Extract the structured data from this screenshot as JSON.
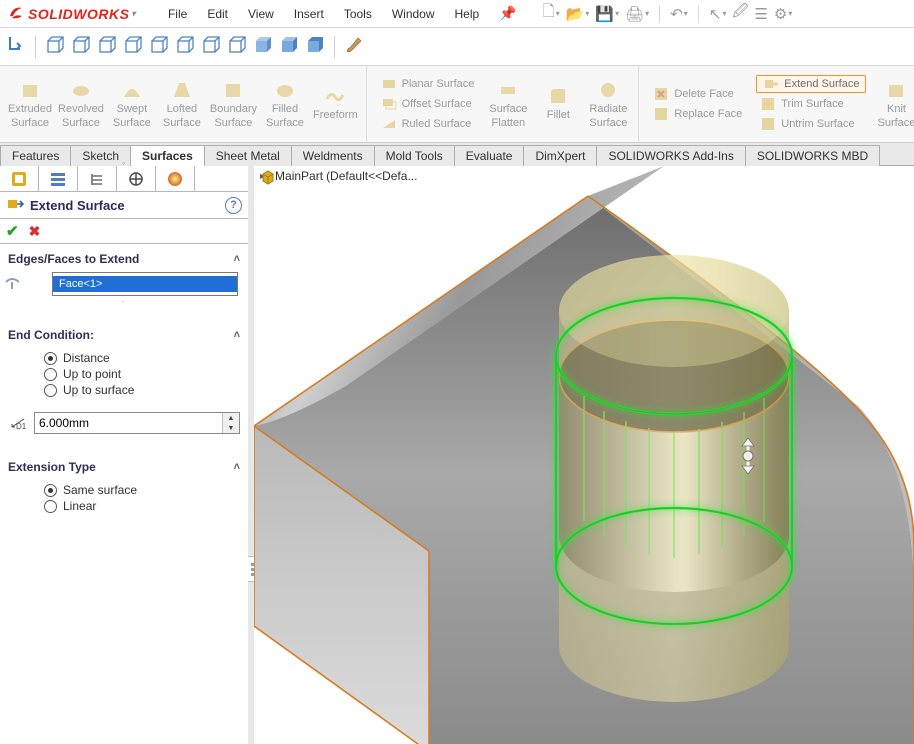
{
  "app": {
    "name": "SOLIDWORKS"
  },
  "menu": {
    "items": [
      "File",
      "Edit",
      "View",
      "Insert",
      "Tools",
      "Window",
      "Help"
    ]
  },
  "ribbon": {
    "big": [
      {
        "l1": "Extruded",
        "l2": "Surface"
      },
      {
        "l1": "Revolved",
        "l2": "Surface"
      },
      {
        "l1": "Swept",
        "l2": "Surface"
      },
      {
        "l1": "Lofted",
        "l2": "Surface"
      },
      {
        "l1": "Boundary",
        "l2": "Surface"
      },
      {
        "l1": "Filled",
        "l2": "Surface"
      },
      {
        "l1": "Freeform",
        "l2": ""
      }
    ],
    "midlist": [
      "Planar Surface",
      "Offset Surface",
      "Ruled Surface"
    ],
    "mid2": [
      {
        "l1": "Surface",
        "l2": "Flatten"
      },
      {
        "l1": "Fillet",
        "l2": ""
      },
      {
        "l1": "Radiate",
        "l2": "Surface"
      }
    ],
    "rightlist1": [
      "Delete Face",
      "Replace Face"
    ],
    "rightlist2": [
      "Extend Surface",
      "Trim Surface",
      "Untrim Surface"
    ],
    "knit": {
      "l1": "Knit",
      "l2": "Surface"
    }
  },
  "tabs": [
    "Features",
    "Sketch",
    "Surfaces",
    "Sheet Metal",
    "Weldments",
    "Mold Tools",
    "Evaluate",
    "DimXpert",
    "SOLIDWORKS Add-Ins",
    "SOLIDWORKS MBD"
  ],
  "tabs_selected": 2,
  "breadcrumb": {
    "part": "MainPart",
    "config": "(Default<<Defa..."
  },
  "cmd": {
    "title": "Extend Surface",
    "sections": {
      "edges": {
        "title": "Edges/Faces to Extend",
        "items": [
          "Face<1>"
        ]
      },
      "endcond": {
        "title": "End Condition:",
        "options": [
          "Distance",
          "Up to point",
          "Up to surface"
        ],
        "selected": 0,
        "distance": "6.000mm"
      },
      "exttype": {
        "title": "Extension Type",
        "options": [
          "Same surface",
          "Linear"
        ],
        "selected": 0
      }
    }
  }
}
